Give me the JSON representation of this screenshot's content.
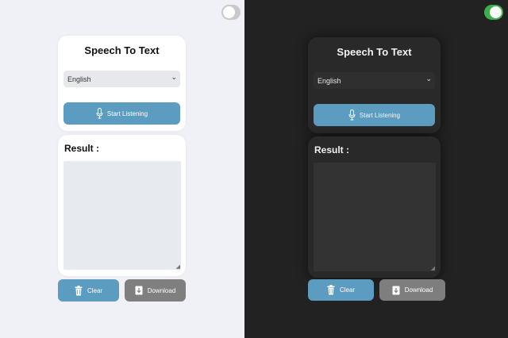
{
  "light": {
    "theme_toggle": {
      "state": "off"
    },
    "title": "Speech To Text",
    "language": {
      "selected": "English"
    },
    "start_button": {
      "label": "Start Listening"
    },
    "result": {
      "label": "Result :",
      "text": ""
    },
    "clear_button": {
      "label": "Clear"
    },
    "download_button": {
      "label": "Download"
    }
  },
  "dark": {
    "theme_toggle": {
      "state": "on"
    },
    "title": "Speech To Text",
    "language": {
      "selected": "English"
    },
    "start_button": {
      "label": "Start Listening"
    },
    "result": {
      "label": "Result :",
      "text": ""
    },
    "clear_button": {
      "label": "Clear"
    },
    "download_button": {
      "label": "Download"
    }
  },
  "icons": {
    "mic": "microphone-icon",
    "trash": "trash-icon",
    "download": "download-icon",
    "chevron": "chevron-down-icon"
  },
  "colors": {
    "accent": "#5b9cc0",
    "toggle_on": "#3fae4a",
    "secondary": "#7f7f7f"
  }
}
